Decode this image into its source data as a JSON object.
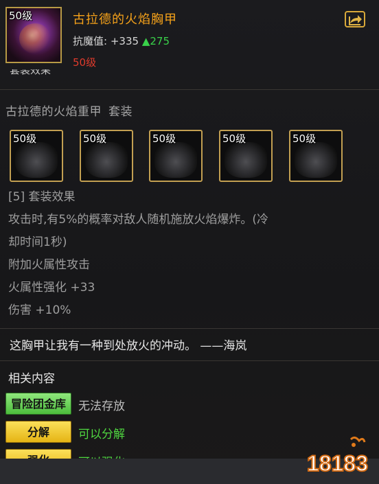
{
  "item": {
    "level_badge": "50级",
    "name": "古拉德的火焰胸甲",
    "stat_label": "抗魔值:",
    "stat_value": "+335",
    "stat_up_value": "275",
    "required_level": "50级",
    "cut_text": "套装效果"
  },
  "set": {
    "name": "古拉德的火焰重甲",
    "suffix": "套装",
    "pieces": [
      {
        "level": "50级",
        "icon": "helmet-icon"
      },
      {
        "level": "50级",
        "icon": "armor-icon"
      },
      {
        "level": "50级",
        "icon": "gauntlet-icon"
      },
      {
        "level": "50级",
        "icon": "belt-icon"
      },
      {
        "level": "50级",
        "icon": "boots-icon"
      }
    ],
    "effects": [
      "[5] 套装效果",
      "攻击时,有5%的概率对敌人随机施放火焰爆炸。(冷",
      "却时间1秒)",
      "附加火属性攻击",
      "火属性强化 +33",
      "伤害 +10%"
    ]
  },
  "flavor_text": "这胸甲让我有一种到处放火的冲动。 ——海岚",
  "related": {
    "title": "相关内容",
    "rows": [
      {
        "tag": "冒险团金库",
        "desc": "无法存放"
      },
      {
        "tag": "分解",
        "desc": "可以分解"
      },
      {
        "tag": "强化",
        "desc": "可以强化"
      }
    ]
  },
  "watermark": "18183",
  "colors": {
    "name": "#f6a21a",
    "up_arrow": "#39d24a",
    "required_level": "#e03b2c",
    "frame_gold": "#c3a052",
    "tag_green": "#5fcf4b",
    "tag_yellow": "#f2c62d"
  }
}
